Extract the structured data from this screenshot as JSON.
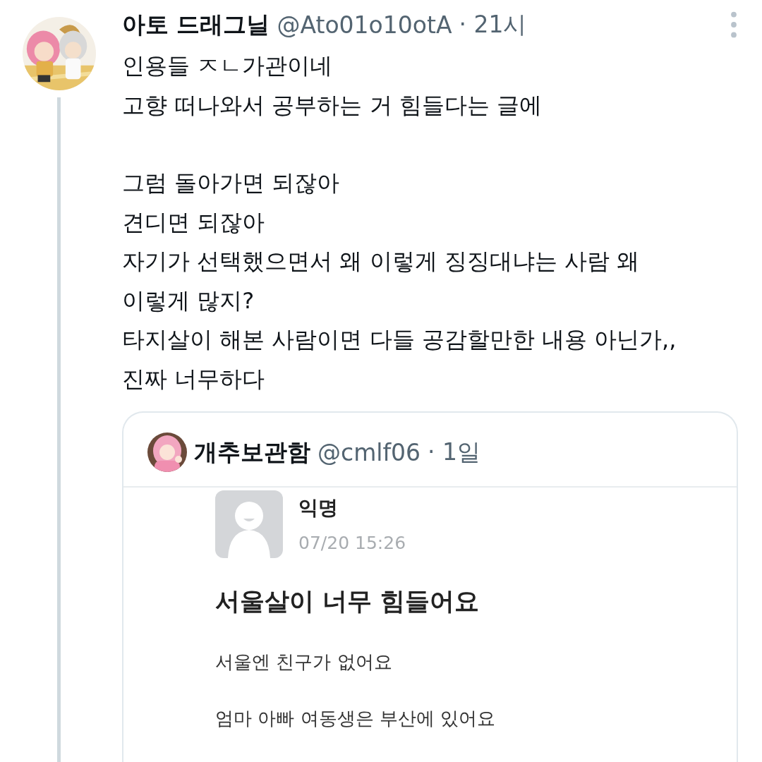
{
  "tweet": {
    "name": "아토 드래그닐",
    "handle": "@Ato01o10otA",
    "time": "· 21시",
    "paragraphs": [
      [
        "인용들 ㅈㄴ가관이네",
        "고향 떠나와서 공부하는 거 힘들다는 글에"
      ],
      [
        "그럼 돌아가면 되잖아",
        "견디면 되잖아",
        "자기가 선택했으면서 왜 이렇게 징징대냐는 사람 왜",
        "이렇게 많지?",
        "타지살이 해본 사람이면 다들 공감할만한 내용 아닌가,,",
        "진짜 너무하다"
      ]
    ]
  },
  "quote": {
    "name": "개추보관함",
    "handle": "@cmlf06",
    "time": "· 1일",
    "post": {
      "author": "익명",
      "date": "07/20 15:26",
      "title": "서울살이 너무 힘들어요",
      "lines": [
        "서울엔 친구가 없어요",
        "엄마 아빠 여동생은 부산에 있어요"
      ]
    }
  }
}
